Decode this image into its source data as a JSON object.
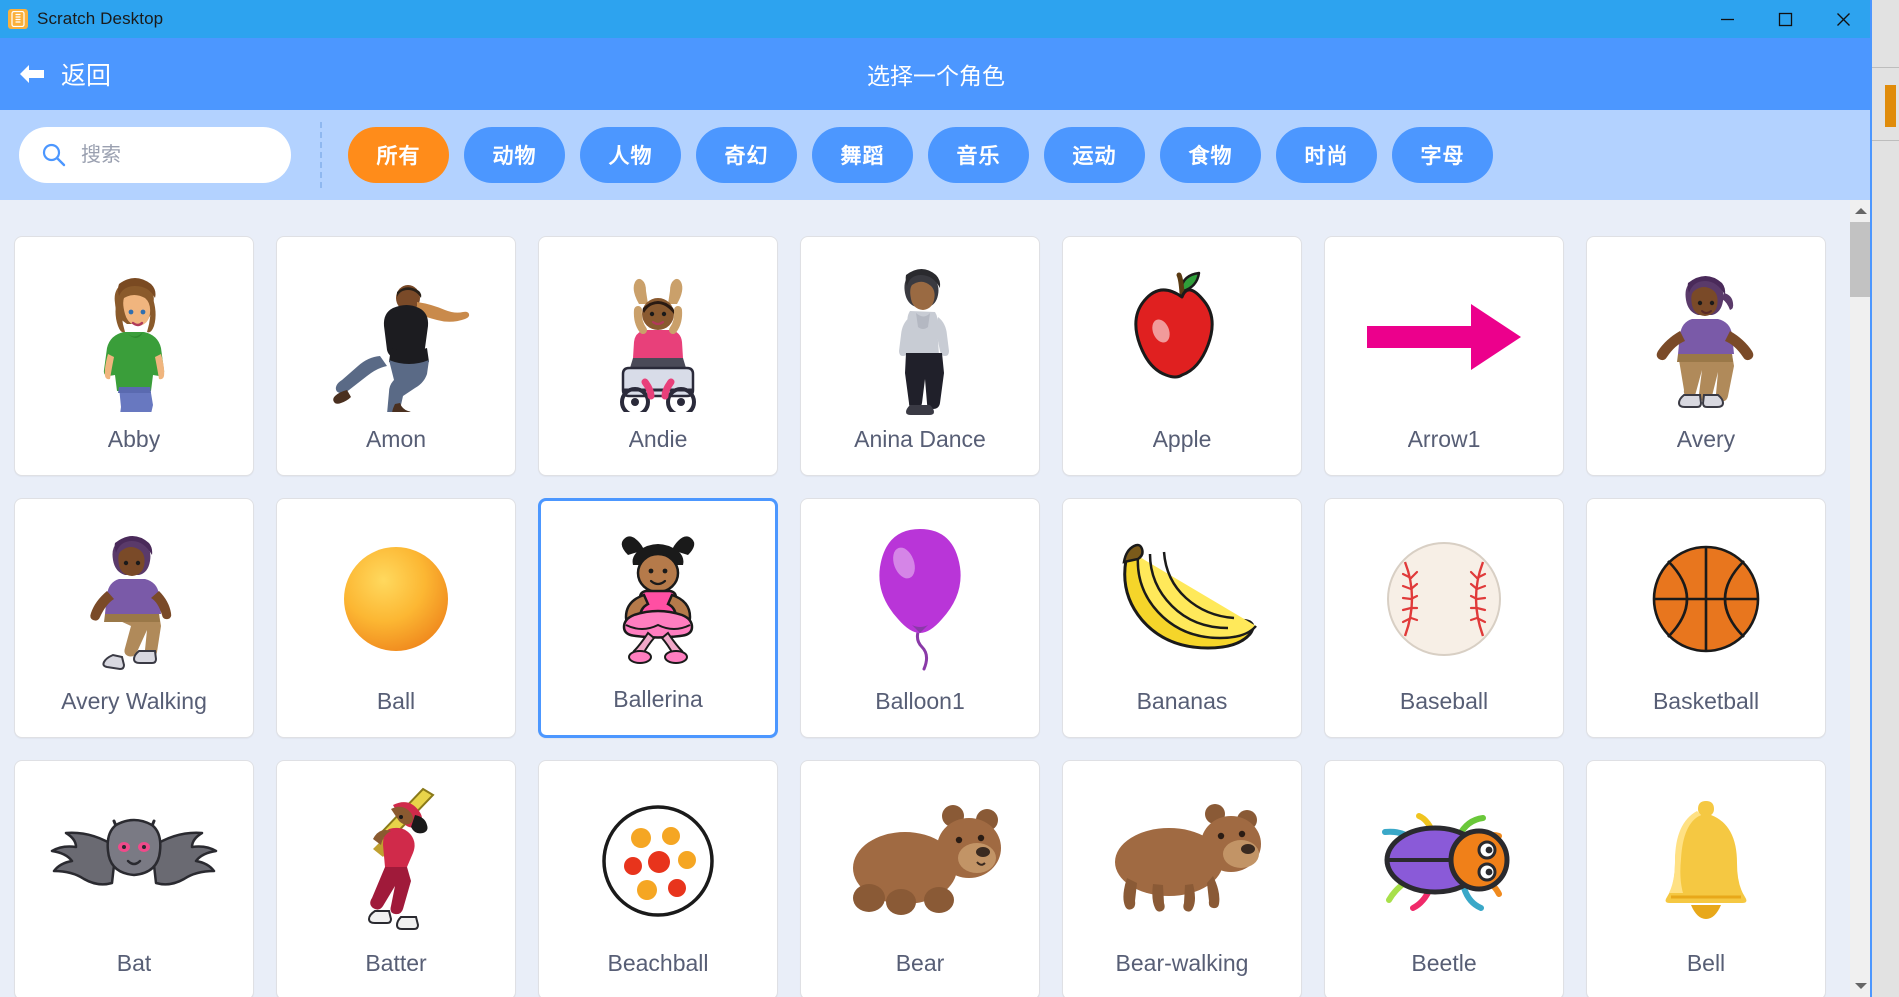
{
  "titlebar": {
    "app_title": "Scratch Desktop",
    "app_icon": "scratch-logo-icon",
    "minimize_label": "minimize-icon",
    "maximize_label": "maximize-icon",
    "close_label": "close-icon",
    "background": "#2da3ef"
  },
  "header": {
    "back_label": "返回",
    "back_icon": "arrow-left-icon",
    "title": "选择一个角色",
    "background": "#4c97ff"
  },
  "search": {
    "placeholder": "搜索",
    "value": "",
    "icon": "search-icon"
  },
  "tags": [
    {
      "label": "所有",
      "active": true
    },
    {
      "label": "动物",
      "active": false
    },
    {
      "label": "人物",
      "active": false
    },
    {
      "label": "奇幻",
      "active": false
    },
    {
      "label": "舞蹈",
      "active": false
    },
    {
      "label": "音乐",
      "active": false
    },
    {
      "label": "运动",
      "active": false
    },
    {
      "label": "食物",
      "active": false
    },
    {
      "label": "时尚",
      "active": false
    },
    {
      "label": "字母",
      "active": false
    }
  ],
  "colors": {
    "accent_active_tag": "#ff8c1a",
    "accent_blue": "#4c97ff",
    "titlebar_blue": "#2da3ef",
    "filterbar_blue": "#b3d2ff",
    "grid_background": "#e9eef8",
    "label_text": "#575e75",
    "selected_border": "#4c97ff"
  },
  "sprites": [
    {
      "name": "Abby",
      "art": "abby",
      "selected": false
    },
    {
      "name": "Amon",
      "art": "amon",
      "selected": false
    },
    {
      "name": "Andie",
      "art": "andie",
      "selected": false
    },
    {
      "name": "Anina Dance",
      "art": "anina",
      "selected": false
    },
    {
      "name": "Apple",
      "art": "apple",
      "selected": false
    },
    {
      "name": "Arrow1",
      "art": "arrow1",
      "selected": false
    },
    {
      "name": "Avery",
      "art": "avery",
      "selected": false
    },
    {
      "name": "Avery Walking",
      "art": "averywalk",
      "selected": false
    },
    {
      "name": "Ball",
      "art": "ball",
      "selected": false
    },
    {
      "name": "Ballerina",
      "art": "ballerina",
      "selected": true
    },
    {
      "name": "Balloon1",
      "art": "balloon1",
      "selected": false
    },
    {
      "name": "Bananas",
      "art": "bananas",
      "selected": false
    },
    {
      "name": "Baseball",
      "art": "baseball",
      "selected": false
    },
    {
      "name": "Basketball",
      "art": "basketball",
      "selected": false
    },
    {
      "name": "Bat",
      "art": "bat",
      "selected": false
    },
    {
      "name": "Batter",
      "art": "batter",
      "selected": false
    },
    {
      "name": "Beachball",
      "art": "beachball",
      "selected": false
    },
    {
      "name": "Bear",
      "art": "bear",
      "selected": false
    },
    {
      "name": "Bear-walking",
      "art": "bearwalking",
      "selected": false
    },
    {
      "name": "Beetle",
      "art": "beetle",
      "selected": false
    },
    {
      "name": "Bell",
      "art": "bell",
      "selected": false
    }
  ],
  "scrollbar": {
    "up_icon": "scroll-up-arrow-icon",
    "down_icon": "scroll-down-arrow-icon",
    "thumb": "scrollbar-thumb"
  }
}
